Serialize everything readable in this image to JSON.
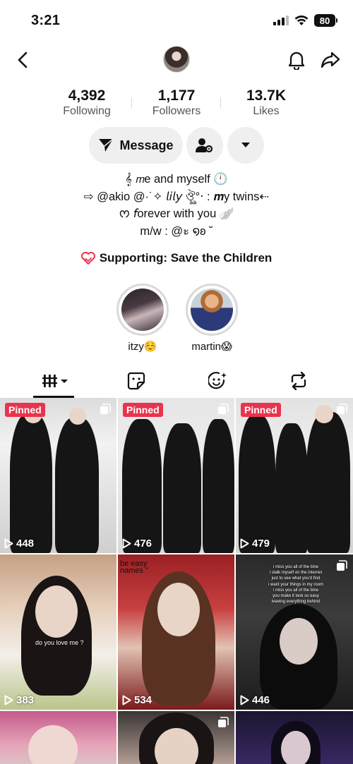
{
  "status_bar": {
    "time": "3:21",
    "battery": "80"
  },
  "stats": [
    {
      "value": "4,392",
      "label": "Following"
    },
    {
      "value": "1,177",
      "label": "Followers"
    },
    {
      "value": "13.7K",
      "label": "Likes"
    }
  ],
  "actions": {
    "message_label": "Message"
  },
  "bio": {
    "line1": "𝄞 𝘮e and myself 🕛",
    "line2": "⇨ @akio @·˙✧ 𝘭𝘪𝘭𝘺 ঔৣ°‧ : 𝒎y twins⇠",
    "line3": "ᰔ 𝘧orever with you 🪽",
    "line4": "m/w : @ะ ໑ʚ ˘"
  },
  "support": {
    "text": "Supporting: Save the Children"
  },
  "highlights": [
    {
      "label": "itzy☺️"
    },
    {
      "label": "martin😱"
    }
  ],
  "grid": {
    "pinned_label": "Pinned",
    "videos": [
      {
        "views": "448",
        "pinned": true
      },
      {
        "views": "476",
        "pinned": true
      },
      {
        "views": "479",
        "pinned": true
      },
      {
        "views": "383",
        "overlay": "do you love me ?"
      },
      {
        "views": "534",
        "overlay": "be easy\nnames \""
      },
      {
        "views": "446",
        "overlay": "i miss you all of the time\ni stalk myself on the internet\njust to see what you'd find\ni want your things in my room\ni miss you all of the time\nyou make it look so easy\nleaving everything behind"
      },
      {
        "views": ""
      },
      {
        "views": ""
      },
      {
        "views": ""
      }
    ]
  },
  "colors": {
    "pinned_bg": "#e8344e",
    "button_bg": "#efefef",
    "support_icon": "#e8344e"
  }
}
